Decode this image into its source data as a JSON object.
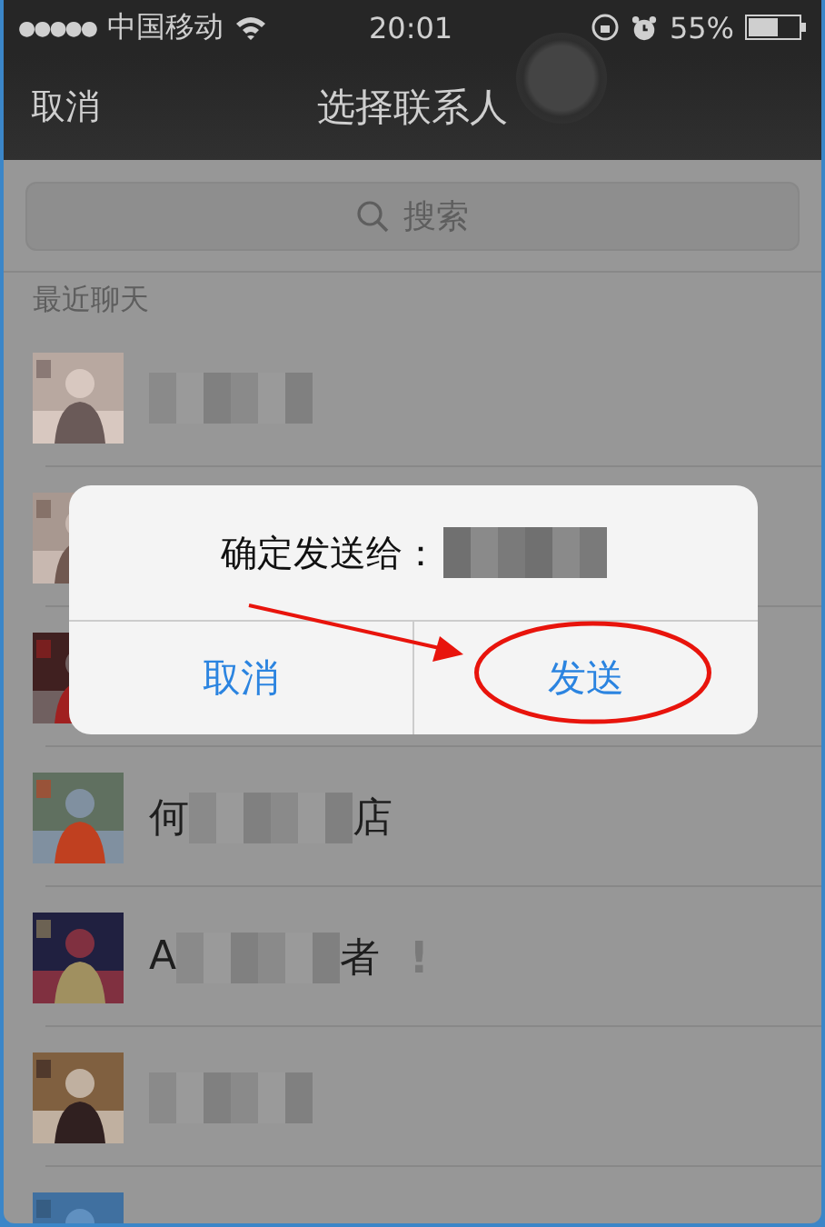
{
  "status_bar": {
    "signal": "●●●●●",
    "carrier": "中国移动",
    "time": "20:01",
    "battery": "55%"
  },
  "nav_bar": {
    "cancel": "取消",
    "title": "选择联系人"
  },
  "search": {
    "placeholder": "搜索"
  },
  "section_header": "最近聊天",
  "contacts": [
    {
      "name_blurred": true
    },
    {
      "name_blurred": false
    },
    {
      "name_blurred": false
    },
    {
      "name_start": "何",
      "name_blurred": true,
      "name_end": "店"
    },
    {
      "name_start": "A",
      "name_blurred": true,
      "name_end": "者",
      "alert": "!"
    },
    {
      "name_blurred": true
    },
    {
      "name_blurred": false
    }
  ],
  "dialog": {
    "message": "确定发送给：",
    "recipient_blurred": true,
    "buttons": [
      {
        "label": "取消",
        "highlighted": false
      },
      {
        "label": "发送",
        "highlighted": true
      }
    ]
  }
}
